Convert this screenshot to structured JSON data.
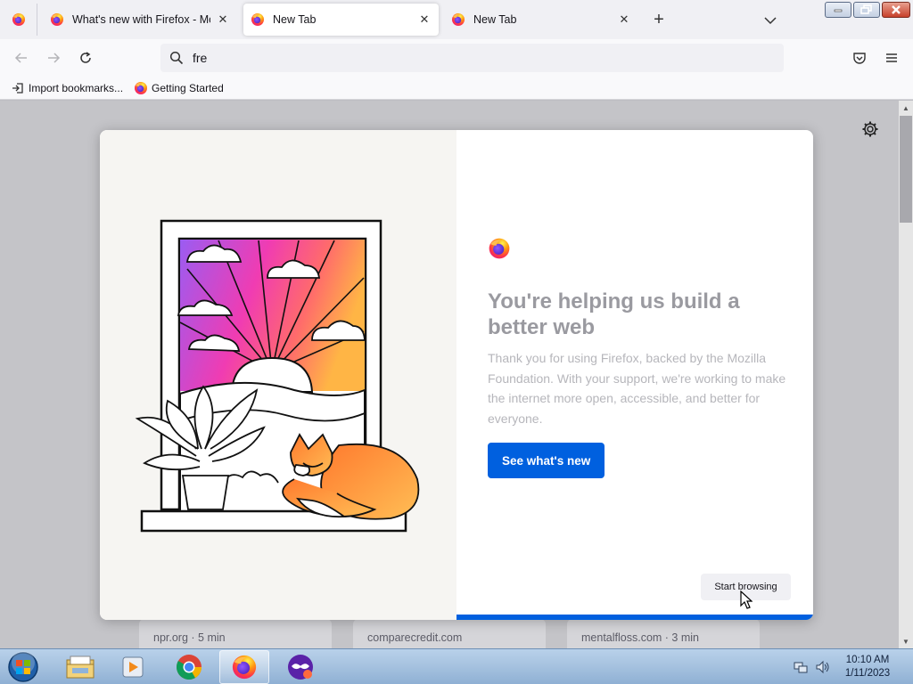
{
  "browser": {
    "tabs": [
      {
        "title": "What's new with Firefox - More",
        "active": false
      },
      {
        "title": "New Tab",
        "active": true
      },
      {
        "title": "New Tab",
        "active": false
      }
    ],
    "url_value": "fre",
    "bookmarks": [
      {
        "label": "Import bookmarks...",
        "icon": "import-icon"
      },
      {
        "label": "Getting Started",
        "icon": "firefox-icon"
      }
    ]
  },
  "modal": {
    "title": "You're helping us build a better web",
    "body": "Thank you for using Firefox, backed by the Mozilla Foundation. With your support, we're working to make the internet more open, accessible, and better for everyone.",
    "primary_button": "See what's new",
    "secondary_button": "Start browsing"
  },
  "top_sites": [
    {
      "label": "npr.org · 5 min"
    },
    {
      "label": "comparecredit.com"
    },
    {
      "label": "mentalfloss.com · 3 min"
    }
  ],
  "taskbar": {
    "apps": [
      "explorer-icon",
      "media-player-icon",
      "chrome-icon",
      "firefox-icon",
      "privacy-app-icon"
    ],
    "clock_time": "10:10 AM",
    "clock_date": "1/11/2023"
  },
  "colors": {
    "accent": "#0060df",
    "firefox_orange": "#ff7139",
    "firefox_purple": "#9059ff"
  }
}
